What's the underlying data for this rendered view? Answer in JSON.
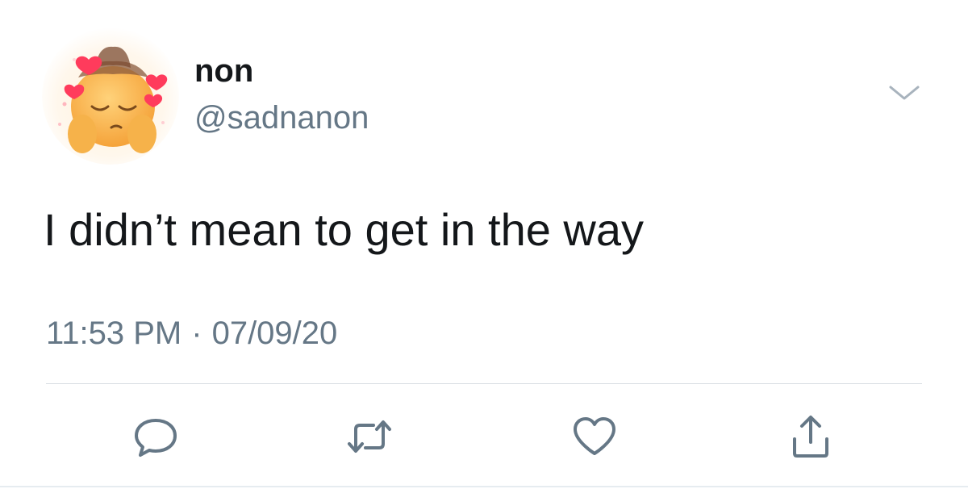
{
  "tweet": {
    "author": {
      "display_name": "non",
      "handle": "@sadnanon",
      "avatar_icon": "pleading-face-cowboy-hearts-emoji"
    },
    "text": "I didn’t mean to get in the way",
    "time": "11:53 PM",
    "separator": "·",
    "date": "07/09/20"
  },
  "actions": {
    "reply_icon": "reply-icon",
    "retweet_icon": "retweet-icon",
    "like_icon": "heart-icon",
    "share_icon": "share-icon"
  },
  "colors": {
    "text_primary": "#14171a",
    "text_secondary": "#657786",
    "icon": "#657786",
    "divider": "#e6ecf0"
  }
}
